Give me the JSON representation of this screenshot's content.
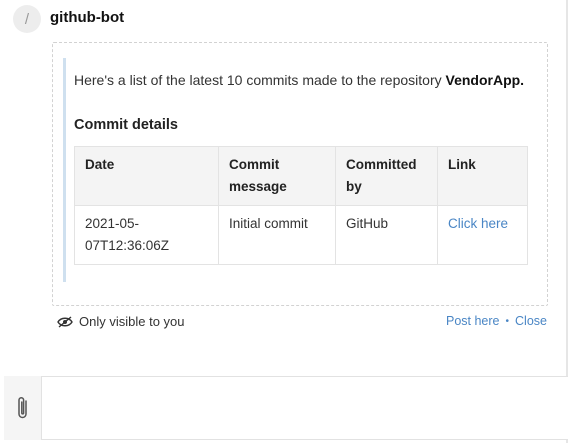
{
  "bot": {
    "avatar_glyph": "/",
    "name": "github-bot"
  },
  "message": {
    "intro_prefix": "Here's a list of the latest 10 commits made to the repository ",
    "repository": "VendorApp.",
    "section_title": "Commit details",
    "table": {
      "headers": [
        "Date",
        "Commit message",
        "Committed by",
        "Link"
      ],
      "rows": [
        {
          "date": "2021-05-07T12:36:06Z",
          "message": "Initial commit",
          "committed_by": "GitHub",
          "link": "Click here"
        }
      ]
    }
  },
  "footer": {
    "visibility": "Only visible to you",
    "post_here": "Post here",
    "separator": "•",
    "close": "Close"
  },
  "composer": {
    "attach_icon": "paperclip-icon"
  },
  "colors": {
    "link": "#4a86c5",
    "card_accent": "#cfe0ef"
  }
}
